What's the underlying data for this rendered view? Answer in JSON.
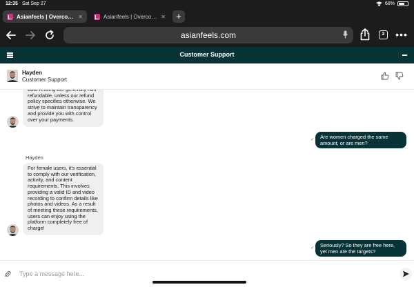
{
  "status_bar": {
    "time": "12:35",
    "date": "Sat Sep 27",
    "battery": "68%",
    "battery_level": 0.68
  },
  "tabs": [
    {
      "title": "Asianfeels | Overcome",
      "active": true
    },
    {
      "title": "Asianfeels | Overcome",
      "active": false
    }
  ],
  "browser": {
    "url": "asianfeels.com",
    "tab_count": "2"
  },
  "support": {
    "title": "Customer Support"
  },
  "agent": {
    "name": "Hayden",
    "role": "Customer Support"
  },
  "messages": [
    {
      "from": "agent",
      "text": "auto-refilling are generally non-refundable, unless our refund policy specifies otherwise. We strive to maintain transparency and provide you with control over your payments."
    },
    {
      "from": "user",
      "text": "Are women charged the same amount, or are men?"
    },
    {
      "from": "agent",
      "sender": "Hayden",
      "text": "For female users, it’s essential to comply with our verification, activity, and content requirements. This involves providing a valid ID and video recording to confirm details like photos and videos. As a result of meeting these requirements, users can enjoy using the platform completely free of charge!"
    },
    {
      "from": "user",
      "text": "Seriously? So they are free here, yet men are the targets?"
    }
  ],
  "composer": {
    "placeholder": "Type a message here..."
  },
  "colors": {
    "brand": "#073337",
    "agent_bubble": "#efefef"
  }
}
